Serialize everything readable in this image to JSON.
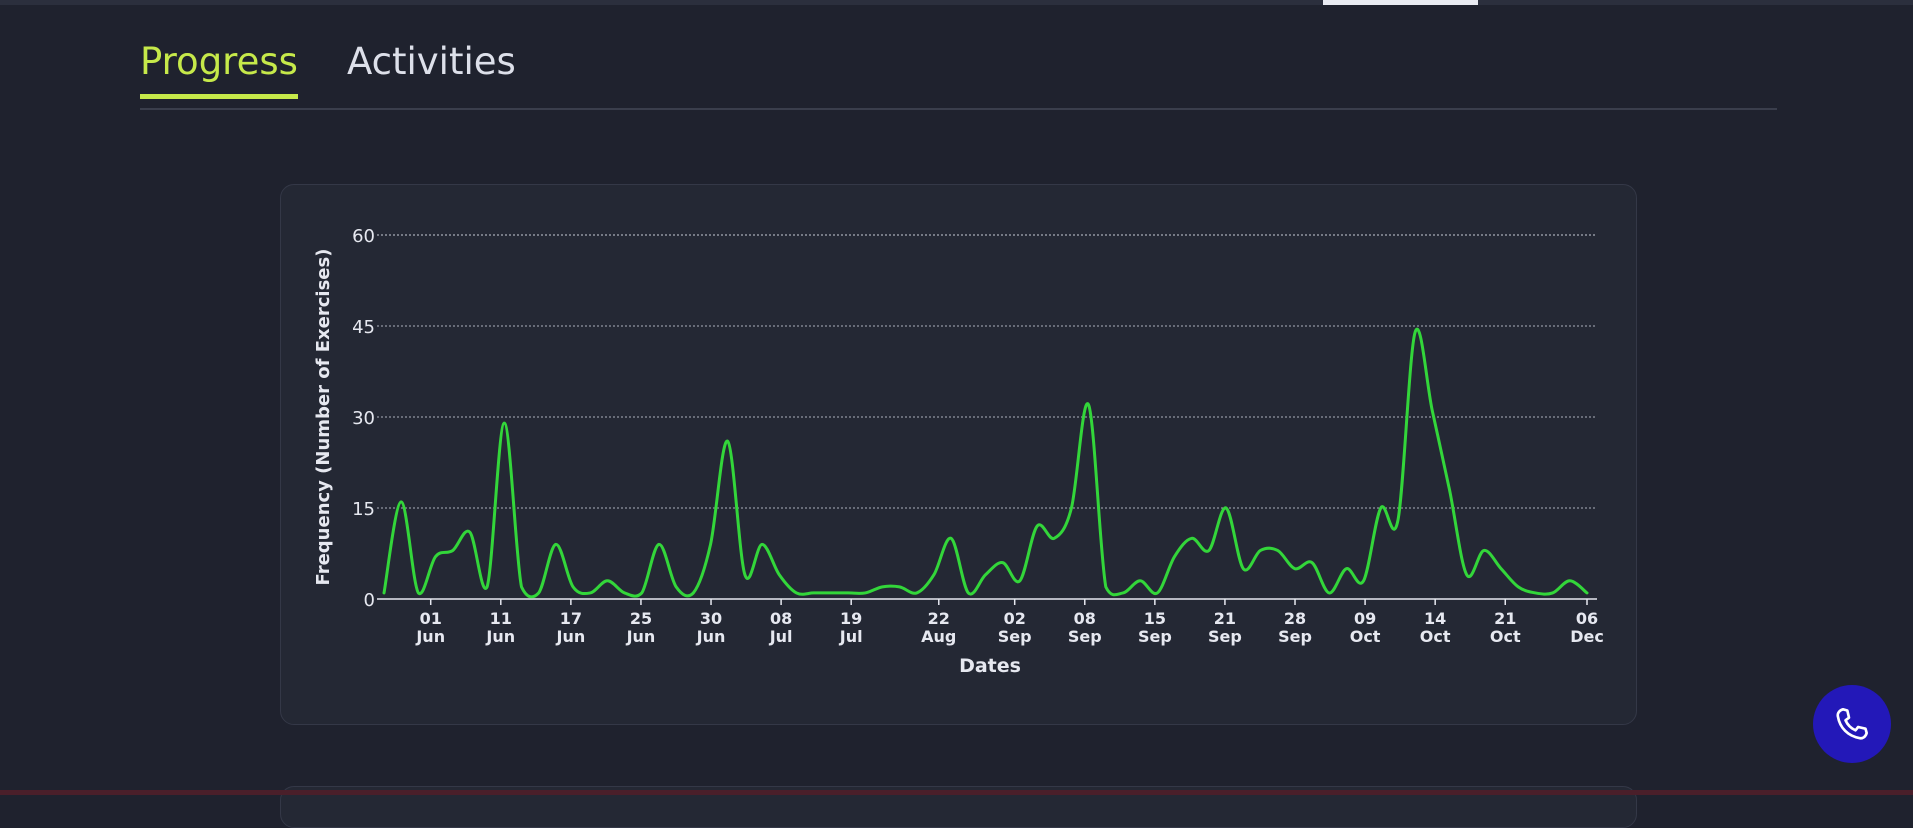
{
  "tabs": [
    {
      "label": "Progress",
      "active": true
    },
    {
      "label": "Activities",
      "active": false
    }
  ],
  "colors": {
    "accent": "#c6e94a",
    "line": "#33d63a",
    "fab": "#2318b8"
  },
  "icons": {
    "fab": "phone-icon"
  },
  "chart_data": {
    "type": "line",
    "title": "",
    "xlabel": "Dates",
    "ylabel": "Frequency (Number of Exercises)",
    "ylim": [
      0,
      60
    ],
    "yticks": [
      0,
      15,
      30,
      45,
      60
    ],
    "grid": true,
    "x_ticks": [
      {
        "day": "01",
        "month": "Jun",
        "pos": 4
      },
      {
        "day": "11",
        "month": "Jun",
        "pos": 10
      },
      {
        "day": "17",
        "month": "Jun",
        "pos": 16
      },
      {
        "day": "25",
        "month": "Jun",
        "pos": 22
      },
      {
        "day": "30",
        "month": "Jun",
        "pos": 28
      },
      {
        "day": "08",
        "month": "Jul",
        "pos": 34
      },
      {
        "day": "19",
        "month": "Jul",
        "pos": 40
      },
      {
        "day": "22",
        "month": "Aug",
        "pos": 47.5
      },
      {
        "day": "02",
        "month": "Sep",
        "pos": 54
      },
      {
        "day": "08",
        "month": "Sep",
        "pos": 60
      },
      {
        "day": "15",
        "month": "Sep",
        "pos": 66
      },
      {
        "day": "21",
        "month": "Sep",
        "pos": 72
      },
      {
        "day": "28",
        "month": "Sep",
        "pos": 78
      },
      {
        "day": "09",
        "month": "Oct",
        "pos": 84
      },
      {
        "day": "14",
        "month": "Oct",
        "pos": 90
      },
      {
        "day": "21",
        "month": "Oct",
        "pos": 96
      },
      {
        "day": "06",
        "month": "Dec",
        "pos": 103
      }
    ],
    "series": [
      {
        "values": [
          1,
          16,
          1,
          7,
          8,
          11,
          2,
          29,
          2,
          1,
          9,
          2,
          1,
          3,
          1,
          1,
          9,
          2,
          1,
          9,
          26,
          4,
          9,
          4,
          1,
          1,
          1,
          1,
          1,
          2,
          2,
          1,
          4,
          10,
          1,
          4,
          6,
          3,
          12,
          10,
          15,
          32,
          2,
          1,
          3,
          1,
          7,
          10,
          8,
          15,
          5,
          8,
          8,
          5,
          6,
          1,
          5,
          3,
          15,
          13,
          44,
          31,
          18,
          4,
          8,
          5,
          2,
          1,
          1,
          3,
          1
        ]
      }
    ]
  }
}
